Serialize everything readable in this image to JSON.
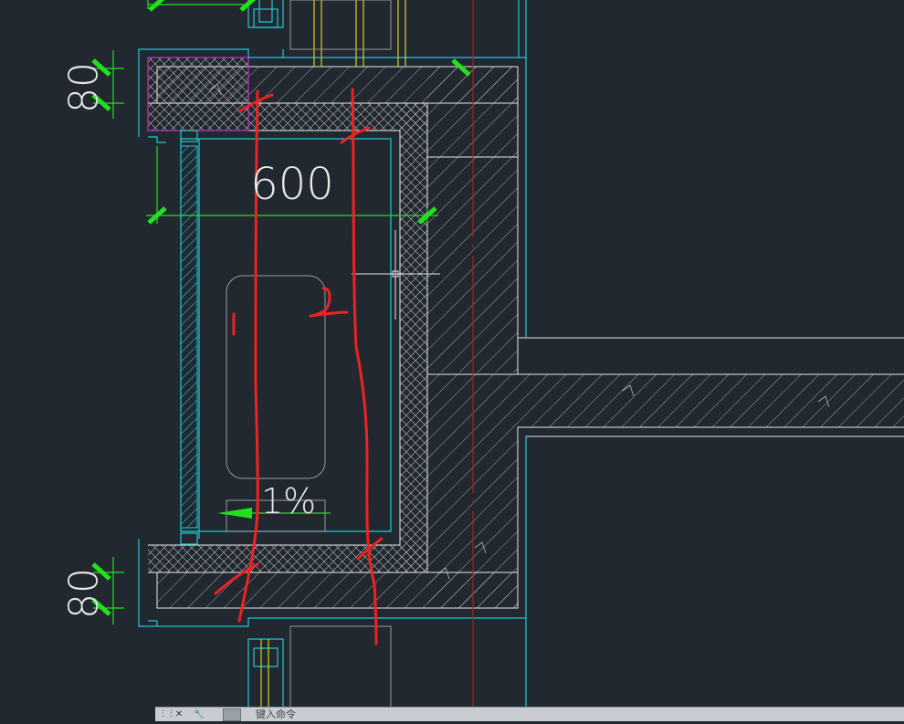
{
  "drawing": {
    "dimensions": {
      "top_80": "80",
      "bottom_80": "80",
      "width_600": "600"
    },
    "slope_label": "1%",
    "markup": {
      "num1": "1",
      "num2": "2"
    }
  },
  "colors": {
    "background": "#212830",
    "cyan": "#22c8d8",
    "green": "#22e01e",
    "red": "#ee2222",
    "white": "#e8e8e8",
    "magenta": "#c030c0",
    "yellow": "#d8d020",
    "gray": "#9a9a9a"
  },
  "command_line": {
    "close_icon": "✕",
    "settings_icon": "🔧",
    "prompt": "键入命令"
  }
}
